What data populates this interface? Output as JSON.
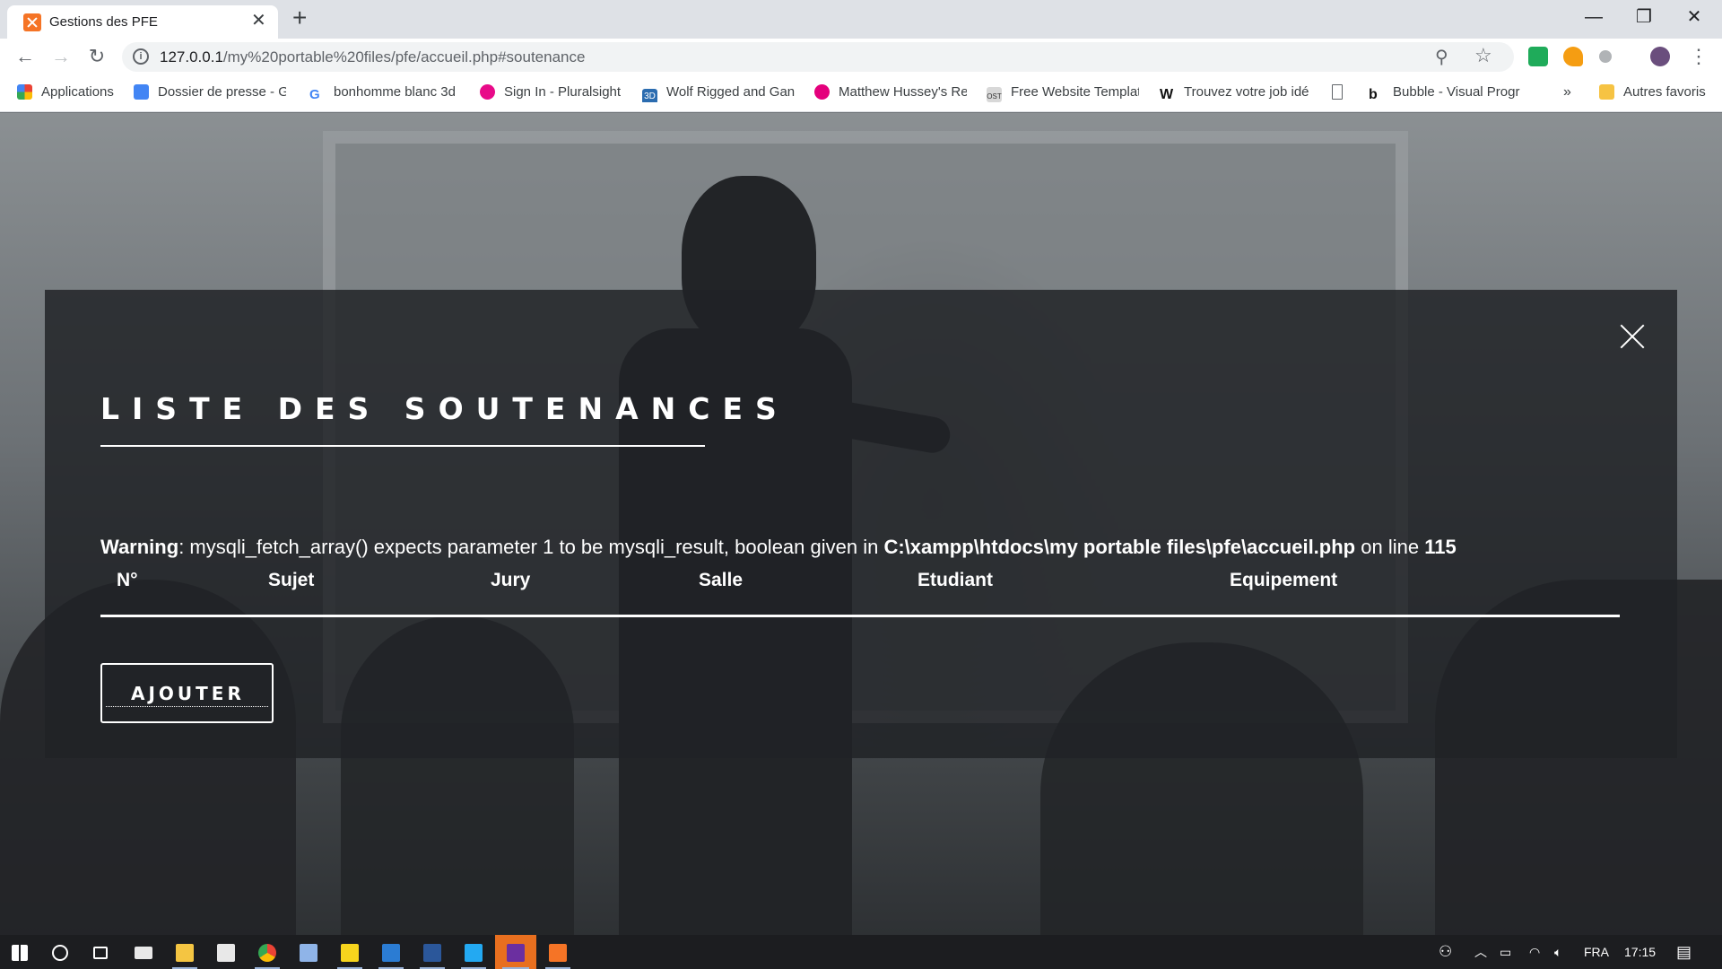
{
  "browser": {
    "tab_title": "Gestions des PFE",
    "tab_close": "✕",
    "new_tab": "+",
    "url_host": "127.0.0.1",
    "url_path": "/my%20portable%20files/pfe/accueil.php#soutenance",
    "window_controls": {
      "minimize": "—",
      "maximize": "❐",
      "close": "✕"
    }
  },
  "bookmarks": [
    {
      "label": "Applications",
      "icon": "apps-grid-icon",
      "color": "#ea4335"
    },
    {
      "label": "Dossier de presse - G",
      "icon": "google-docs-icon",
      "color": "#4285f4"
    },
    {
      "label": "bonhomme blanc 3d",
      "icon": "google-icon",
      "color": "#ea4335"
    },
    {
      "label": "Sign In - Pluralsight",
      "icon": "pluralsight-icon",
      "color": "#e80a89"
    },
    {
      "label": "Wolf Rigged and Gan",
      "icon": "3d-icon",
      "color": "#2b6cb0"
    },
    {
      "label": "Matthew Hussey's Re",
      "icon": "circles-icon",
      "color": "#e4007c"
    },
    {
      "label": "Free Website Templat",
      "icon": "ost-icon",
      "color": "#555555"
    },
    {
      "label": "Trouvez votre job idé",
      "icon": "w-icon",
      "color": "#111111"
    },
    {
      "label": "",
      "icon": "page-icon",
      "color": "#5f6368"
    },
    {
      "label": "Bubble - Visual Progr",
      "icon": "bubble-icon",
      "color": "#111111"
    },
    {
      "label": "Autres favoris",
      "icon": "folder-icon",
      "color": "#f6c343"
    }
  ],
  "bookmarks_overflow": "»",
  "modal": {
    "title": "LISTE DES SOUTENANCES",
    "warning": {
      "prefix": "Warning",
      "message": ": mysqli_fetch_array() expects parameter 1 to be mysqli_result, boolean given in ",
      "file": "C:\\xampp\\htdocs\\my portable files\\pfe\\accueil.php",
      "middle": " on line ",
      "line": "115"
    },
    "columns": [
      "N°",
      "Sujet",
      "Jury",
      "Salle",
      "Etudiant",
      "Equipement"
    ],
    "add_button": "AJOUTER"
  },
  "taskbar": {
    "language": "FRA",
    "time": "17:15"
  },
  "colors": {
    "modal_bg": "#202226",
    "accent_orange": "#f57426",
    "taskbar_bg": "#1c1d20"
  }
}
